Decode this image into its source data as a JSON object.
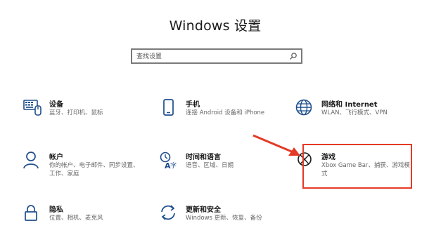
{
  "window": {
    "title": "Windows 设置"
  },
  "search": {
    "placeholder": "查找设置"
  },
  "tiles": [
    {
      "id": "devices",
      "name": "设备",
      "desc": "蓝牙、打印机、鼠标",
      "icon": "devices-icon"
    },
    {
      "id": "phone",
      "name": "手机",
      "desc": "连接 Android 设备和 iPhone",
      "icon": "phone-icon"
    },
    {
      "id": "network",
      "name": "网络和 Internet",
      "desc": "WLAN、飞行模式、VPN",
      "icon": "globe-icon"
    },
    {
      "id": "accounts",
      "name": "帐户",
      "desc": "你的帐户、电子邮件、同步设置、工作、家庭",
      "icon": "person-icon"
    },
    {
      "id": "time-language",
      "name": "时间和语言",
      "desc": "语音、区域、日期",
      "icon": "time-language-icon"
    },
    {
      "id": "gaming",
      "name": "游戏",
      "desc": "Xbox Game Bar、捕获、游戏模式",
      "icon": "xbox-icon"
    },
    {
      "id": "privacy",
      "name": "隐私",
      "desc": "位置、相机、麦克风",
      "icon": "lock-icon"
    },
    {
      "id": "update-security",
      "name": "更新和安全",
      "desc": "Windows 更新、恢复、备份",
      "icon": "sync-icon"
    }
  ],
  "colors": {
    "icon": "#1f4e8c",
    "highlight": "#e53a27",
    "title": "#1a1a1a",
    "desc": "#666666"
  }
}
